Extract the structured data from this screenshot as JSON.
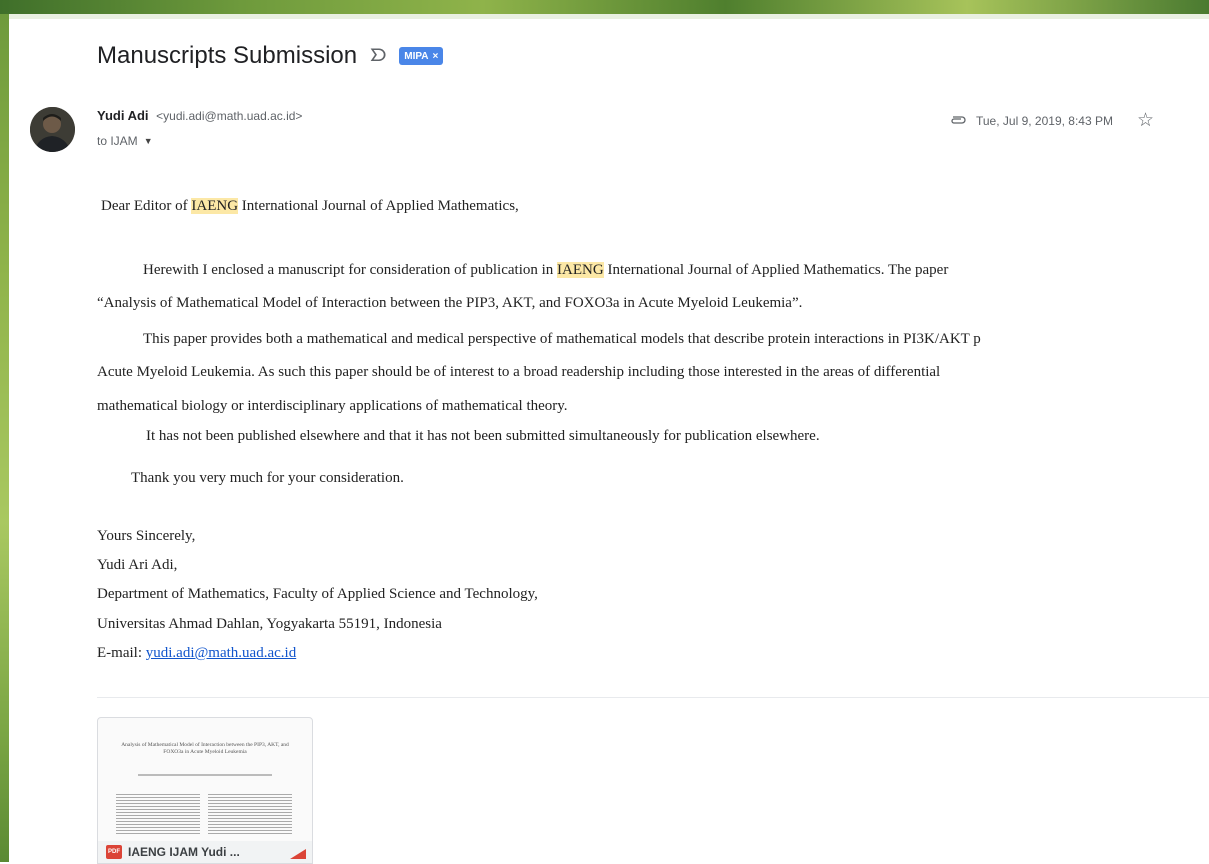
{
  "subject": {
    "title": "Manuscripts Submission",
    "label": "MIPA",
    "label_close": "×"
  },
  "sender": {
    "name": "Yudi Adi",
    "email": "<yudi.adi@math.uad.ac.id>",
    "to": "to IJAM"
  },
  "meta": {
    "date": "Tue, Jul 9, 2019, 8:43 PM"
  },
  "body": {
    "greeting_pre": "Dear Editor of ",
    "highlight": "IAENG",
    "greeting_post": " International Journal of Applied Mathematics,",
    "p1_pre": "Herewith I enclosed a manuscript for consideration of publication in ",
    "p1_post": " International Journal of Applied Mathematics. The paper",
    "p1_line2": "“Analysis of Mathematical Model of Interaction between the PIP3, AKT, and FOXO3a in Acute Myeloid Leukemia”.",
    "p2_line1": "This paper provides both a mathematical and medical perspective of mathematical models that describe protein interactions in PI3K/AKT p",
    "p2_line2": "Acute Myeloid Leukemia. As such this paper should be of interest to a broad readership including those interested in the areas of differential",
    "p2_line3": "mathematical biology or interdisciplinary applications of mathematical theory.",
    "p3": "It has not been published elsewhere and that it has not been submitted simultaneously for publication elsewhere.",
    "thanks": "Thank you very much for your consideration.",
    "closing": "Yours Sincerely,",
    "sig_name": "Yudi Ari Adi,",
    "sig_dept": "Department of Mathematics, Faculty of Applied Science and Technology,",
    "sig_univ": "Universitas Ahmad Dahlan, Yogyakarta 55191, Indonesia",
    "sig_email_label": "E-mail: ",
    "sig_email": "yudi.adi@math.uad.ac.id"
  },
  "attachment": {
    "thumb_title": "Analysis of Mathematical Model of Interaction between the PIP3, AKT, and FOXO3a in Acute Myeloid Leukemia",
    "type_badge": "PDF",
    "name": "IAENG IJAM Yudi ..."
  },
  "icons": {
    "important": "important-marker-icon",
    "attachment": "paperclip-icon",
    "star": "star-icon",
    "caret": "chevron-down-icon",
    "pdf": "pdf-icon",
    "drive": "drive-icon"
  },
  "colors": {
    "label": "#4a86e8",
    "highlight": "#fce8a6",
    "link": "#1155cc",
    "pdf": "#db4437"
  }
}
